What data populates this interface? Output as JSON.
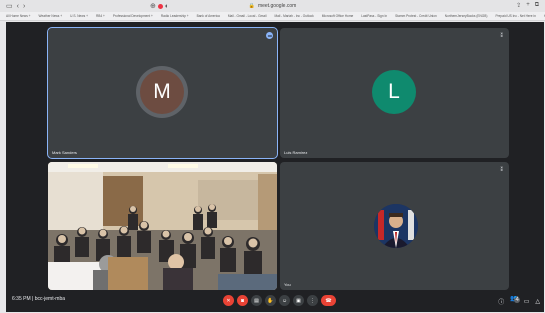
{
  "browser": {
    "url": "meet.google.com",
    "bookmarks": [
      "All Home News +",
      "Weather News +",
      "U.S. News +",
      "RB4 +",
      "Professional Development +",
      "Radio Leadership +",
      "Bank of America",
      "Mail - Gmail - Local - Gmail",
      "Mail - Mariah - Inc - Outlook",
      "Microsoft Office Home",
      "LastPass - Sign In",
      "Stamm Protest - Credit Union",
      "NorthernJerseyBooks (ENGB)",
      "Prepaid US Inc - Net Here in",
      "Health & Fitness +"
    ]
  },
  "participants": [
    {
      "name": "Mark Sanders",
      "initial": "M",
      "avatar_color": "#6d4c41"
    },
    {
      "name": "Luis Ramirez",
      "initial": "L",
      "avatar_color": "#0f8a6e"
    },
    {
      "name": ""
    },
    {
      "name": "You"
    }
  ],
  "meeting": {
    "time": "6:35 PM",
    "separator": "|",
    "code": "bcc-jemt-mba",
    "participant_count": "4"
  }
}
